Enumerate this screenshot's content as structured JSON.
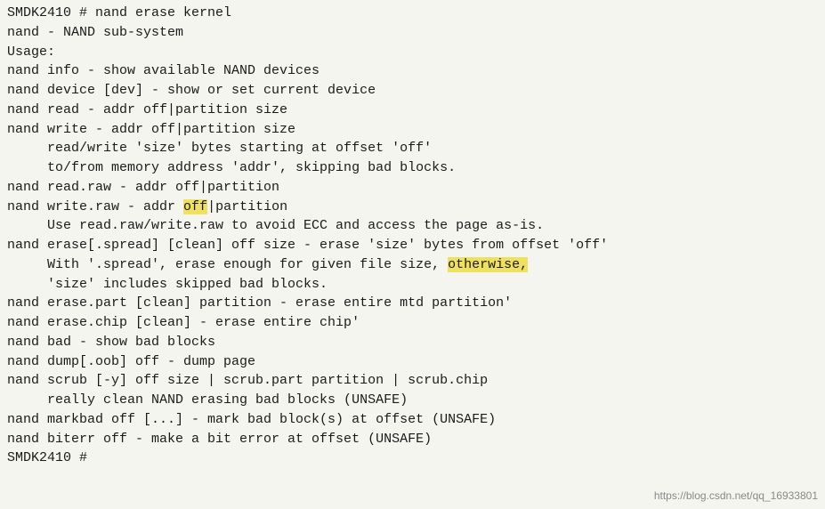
{
  "terminal": {
    "lines": [
      {
        "id": "l1",
        "text": "SMDK2410 # nand erase kernel",
        "highlight": null
      },
      {
        "id": "l2",
        "text": "nand - NAND sub-system",
        "highlight": null
      },
      {
        "id": "l3",
        "text": "",
        "highlight": null
      },
      {
        "id": "l4",
        "text": "Usage:",
        "highlight": null
      },
      {
        "id": "l5",
        "text": "nand info - show available NAND devices",
        "highlight": null
      },
      {
        "id": "l6",
        "text": "nand device [dev] - show or set current device",
        "highlight": null
      },
      {
        "id": "l7",
        "text": "nand read - addr off|partition size",
        "highlight": null
      },
      {
        "id": "l8",
        "text": "nand write - addr off|partition size",
        "highlight": null
      },
      {
        "id": "l9",
        "text": "     read/write 'size' bytes starting at offset 'off'",
        "highlight": null
      },
      {
        "id": "l10",
        "text": "     to/from memory address 'addr', skipping bad blocks.",
        "highlight": null
      },
      {
        "id": "l11",
        "text": "nand read.raw - addr off|partition",
        "highlight": null
      },
      {
        "id": "l12",
        "text": "nand write.raw - addr off|partition",
        "highlight": {
          "start": 26,
          "end": 29,
          "word": "off"
        }
      },
      {
        "id": "l13",
        "text": "     Use read.raw/write.raw to avoid ECC and access the page as-is.",
        "highlight": null
      },
      {
        "id": "l14",
        "text": "nand erase[.spread] [clean] off size - erase 'size' bytes from offset 'off'",
        "highlight": null
      },
      {
        "id": "l15",
        "text": "     With '.spread', erase enough for given file size, otherwise,",
        "highlight": {
          "start": 57,
          "end": 67,
          "word": "otherwise,"
        }
      },
      {
        "id": "l16",
        "text": "     'size' includes skipped bad blocks.",
        "highlight": null
      },
      {
        "id": "l17",
        "text": "nand erase.part [clean] partition - erase entire mtd partition'",
        "highlight": null
      },
      {
        "id": "l18",
        "text": "nand erase.chip [clean] - erase entire chip'",
        "highlight": null
      },
      {
        "id": "l19",
        "text": "nand bad - show bad blocks",
        "highlight": null
      },
      {
        "id": "l20",
        "text": "nand dump[.oob] off - dump page",
        "highlight": null
      },
      {
        "id": "l21",
        "text": "nand scrub [-y] off size | scrub.part partition | scrub.chip",
        "highlight": null
      },
      {
        "id": "l22",
        "text": "     really clean NAND erasing bad blocks (UNSAFE)",
        "highlight": null
      },
      {
        "id": "l23",
        "text": "nand markbad off [...] - mark bad block(s) at offset (UNSAFE)",
        "highlight": null
      },
      {
        "id": "l24",
        "text": "nand biterr off - make a bit error at offset (UNSAFE)",
        "highlight": null
      },
      {
        "id": "l25",
        "text": "SMDK2410 #",
        "highlight": null
      }
    ],
    "watermark": "https://blog.csdn.net/qq_16933801"
  }
}
